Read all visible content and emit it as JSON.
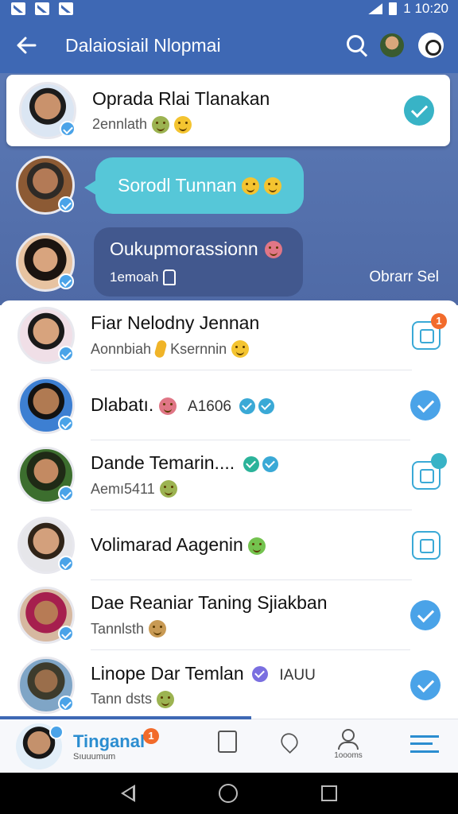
{
  "status_bar": {
    "time": "1 10:20"
  },
  "app_bar": {
    "title": "Dalaiosiail Nlopmai"
  },
  "pinned": {
    "name": "Oprada Rlai Tlanakan",
    "subtitle": "2ennlath"
  },
  "messages": [
    {
      "text": "Sorodl Tunnan"
    },
    {
      "text": "Oukupmorassionn",
      "sub": "1emoah"
    }
  ],
  "more_link": "Obrarr Sel",
  "list": [
    {
      "name": "Fiar Nelodny Jennan",
      "sub_a": "Aonnbiah",
      "sub_b": "Ksernnin",
      "badge": "1"
    },
    {
      "name": "Dlabatı.",
      "suffix": "A1606"
    },
    {
      "name": "Dande Temarin....",
      "sub_a": "Aemı5411"
    },
    {
      "name": "Volimarad Aagenin"
    },
    {
      "name": "Dae Reaniar Taning Sjiakban",
      "sub_a": "Tannlsth"
    },
    {
      "name": "Linope Dar Temlan",
      "suffix": "IAUU",
      "sub_a": "Tann dsts"
    }
  ],
  "bottom_nav": {
    "brand": "Tinganal",
    "brand_sub": "Sıuuumum",
    "brand_badge": "1",
    "profile_label": "1oooms"
  },
  "colors": {
    "primary": "#3e68b4",
    "accent": "#4aa3e8",
    "badge": "#f26b2b"
  }
}
